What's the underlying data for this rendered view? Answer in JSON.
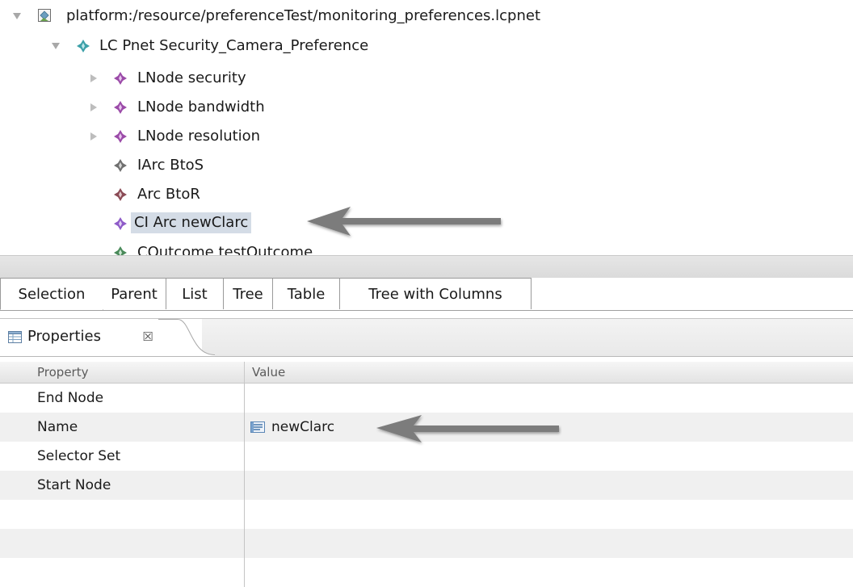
{
  "tree": {
    "items": [
      {
        "label": "platform:/resource/preferenceTest/monitoring_preferences.lcpnet",
        "icon": "resource-file-icon",
        "expanded": true
      },
      {
        "label": "LC Pnet Security_Camera_Preference",
        "icon": "diamond-node-icon",
        "expanded": true
      },
      {
        "label": "LNode security",
        "icon": "diamond-node-icon",
        "expanded": false
      },
      {
        "label": "LNode bandwidth",
        "icon": "diamond-node-icon",
        "expanded": false
      },
      {
        "label": "LNode resolution",
        "icon": "diamond-node-icon",
        "expanded": false
      },
      {
        "label": "IArc BtoS",
        "icon": "diamond-node-icon"
      },
      {
        "label": "Arc BtoR",
        "icon": "diamond-node-icon"
      },
      {
        "label": "CI Arc newClarc",
        "icon": "diamond-node-icon",
        "selected": true
      },
      {
        "label": "COutcome testOutcome",
        "icon": "diamond-node-icon"
      }
    ]
  },
  "editor_tabs": [
    "Selection",
    "Parent",
    "List",
    "Tree",
    "Table",
    "Tree with Columns"
  ],
  "properties": {
    "title": "Properties",
    "close_glyph": "☒",
    "columns": [
      "Property",
      "Value"
    ],
    "rows": [
      {
        "property": "End Node",
        "value": ""
      },
      {
        "property": "Name",
        "value": "newClarc"
      },
      {
        "property": "Selector Set",
        "value": ""
      },
      {
        "property": "Start Node",
        "value": ""
      }
    ]
  },
  "colors": {
    "selection": "#d4dce6",
    "icon_purple": "#9b4ba8",
    "icon_teal": "#3ca0a8",
    "icon_gray": "#6f6f6f",
    "arrow": "#7b7b7b"
  }
}
